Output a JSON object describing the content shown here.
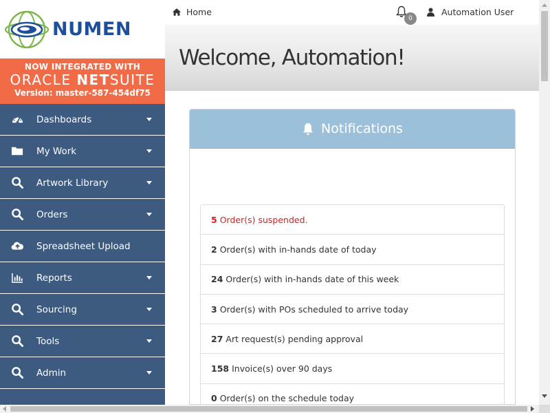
{
  "brand": {
    "logo_text": "NUMEN",
    "banner_line1": "NOW INTEGRATED WITH",
    "banner_oracle": "ORACLE",
    "banner_net": "NET",
    "banner_suite": "SUITE",
    "version": "Version: master-587-454df75",
    "banner_color": "#f26b47",
    "logo_color": "#1e4f9b"
  },
  "sidebar": {
    "bg_color": "#3d5a80",
    "items": [
      {
        "label": "Dashboards",
        "icon": "dashboard-icon"
      },
      {
        "label": "My Work",
        "icon": "folder-icon"
      },
      {
        "label": "Artwork Library",
        "icon": "search-icon"
      },
      {
        "label": "Orders",
        "icon": "search-icon"
      },
      {
        "label": "Spreadsheet Upload",
        "icon": "cloud-upload-icon"
      },
      {
        "label": "Reports",
        "icon": "bar-chart-icon"
      },
      {
        "label": "Sourcing",
        "icon": "search-icon"
      },
      {
        "label": "Tools",
        "icon": "search-icon"
      },
      {
        "label": "Admin",
        "icon": "search-icon"
      }
    ]
  },
  "topbar": {
    "home_label": "Home",
    "notification_count": "0",
    "user_name": "Automation User"
  },
  "welcome": {
    "title": "Welcome, Automation!"
  },
  "notifications": {
    "title": "Notifications",
    "header_color": "#9cc0da",
    "items": [
      {
        "count": "5",
        "text": "Order(s) suspended.",
        "alert": true
      },
      {
        "count": "2",
        "text": "Order(s) with in-hands date of today"
      },
      {
        "count": "24",
        "text": "Order(s) with in-hands date of this week"
      },
      {
        "count": "3",
        "text": "Order(s) with POs scheduled to arrive today"
      },
      {
        "count": "27",
        "text": "Art request(s) pending approval"
      },
      {
        "count": "158",
        "text": "Invoice(s) over 90 days"
      },
      {
        "count": "0",
        "text": "Order(s) on the schedule today"
      }
    ]
  }
}
